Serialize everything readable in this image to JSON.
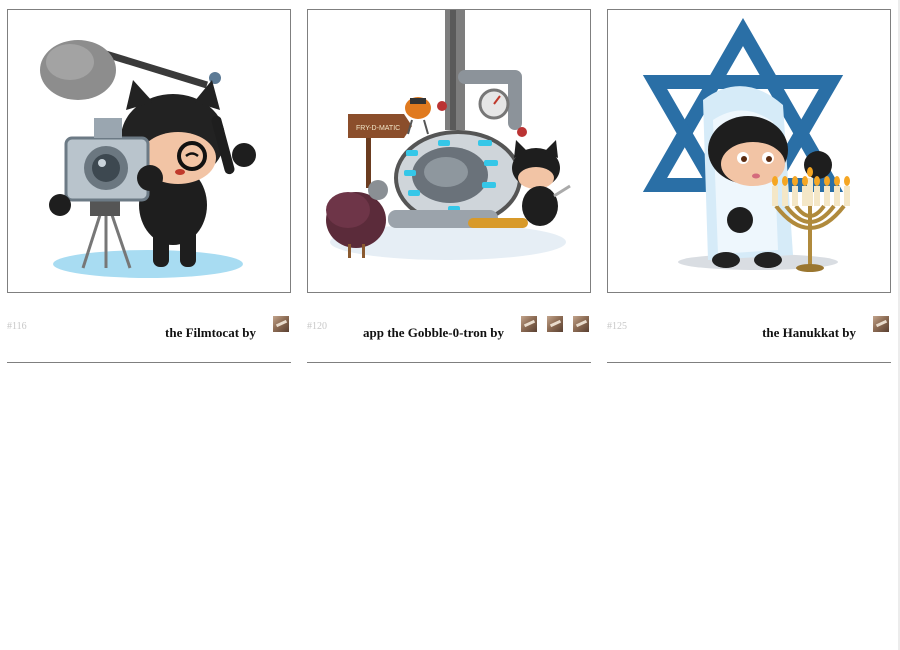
{
  "cards": [
    {
      "number": "#116",
      "title": "the Filmtocat by",
      "contributors": [
        "contributor-avatar"
      ],
      "image_name": "filmtocat"
    },
    {
      "number": "#120",
      "title": "app the Gobble-0-tron by",
      "contributors": [
        "contributor-avatar",
        "contributor-avatar",
        "contributor-avatar"
      ],
      "image_name": "gobble-o-tron",
      "sign_text": "FRY-D-MATIC"
    },
    {
      "number": "#125",
      "title": "the Hanukkat by",
      "contributors": [
        "contributor-avatar"
      ],
      "image_name": "hanukkat"
    }
  ],
  "colors": {
    "frame_border": "#7f7f7f",
    "number_text": "#c8c8c8",
    "title_text": "#111111",
    "star_blue": "#2a6fa6"
  }
}
